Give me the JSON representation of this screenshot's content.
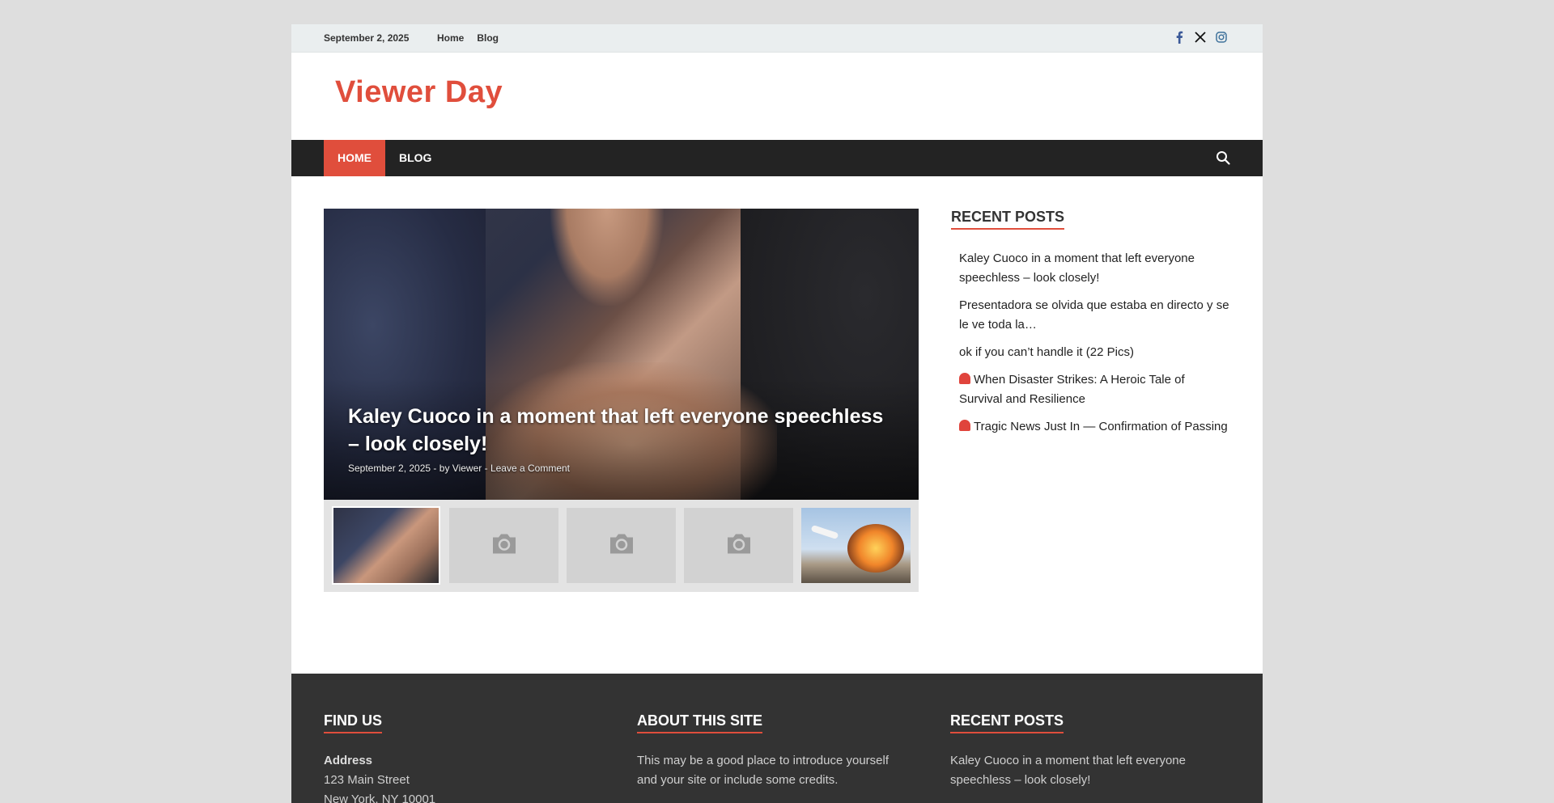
{
  "topbar": {
    "date": "September 2, 2025",
    "links": [
      "Home",
      "Blog"
    ],
    "social": [
      {
        "icon": "facebook-icon",
        "color": "#3b5998"
      },
      {
        "icon": "x-icon",
        "color": "#111111"
      },
      {
        "icon": "instagram-icon",
        "color": "#3f729b"
      }
    ]
  },
  "header": {
    "site_title": "Viewer Day"
  },
  "nav": {
    "items": [
      "Home",
      "Blog"
    ],
    "active_index": 0
  },
  "slider": {
    "headline": "Kaley Cuoco in a moment that left everyone speechless – look closely!",
    "date": "September 2, 2025",
    "separator": "-",
    "by_prefix": "by",
    "author": "Viewer",
    "comment_link": "Leave a Comment"
  },
  "sidebar": {
    "title": "Recent Posts",
    "posts": [
      {
        "text": "Kaley Cuoco in a moment that left everyone speechless – look closely!",
        "emoji": false
      },
      {
        "text": "Presentadora se olvida que estaba en directo y se le ve toda la…",
        "emoji": false
      },
      {
        "text": "ok if you can’t handle it (22 Pics)",
        "emoji": false
      },
      {
        "text": "When Disaster Strikes: A Heroic Tale of Survival and Resilience",
        "emoji": true
      },
      {
        "text": "Tragic News Just In — Confirmation of Passing",
        "emoji": true
      }
    ]
  },
  "footer": {
    "find_us": {
      "title": "Find Us",
      "address_label": "Address",
      "address_line1": "123 Main Street",
      "address_line2": "New York, NY 10001"
    },
    "about": {
      "title": "About This Site",
      "text": "This may be a good place to introduce yourself and your site or include some credits."
    },
    "recent": {
      "title": "Recent Posts",
      "first_post": "Kaley Cuoco in a moment that left everyone speechless – look closely!"
    }
  },
  "colors": {
    "accent": "#e04e3c",
    "nav_bg": "#232323",
    "footer_bg": "#333333"
  }
}
